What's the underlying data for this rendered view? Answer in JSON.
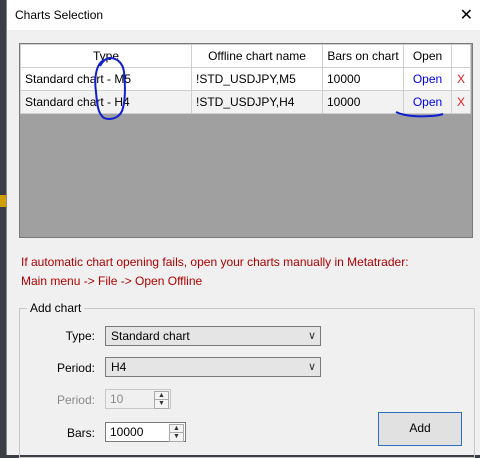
{
  "window": {
    "title": "Charts Selection",
    "close_glyph": "✕"
  },
  "table": {
    "headers": [
      "Type",
      "Offline chart name",
      "Bars on chart",
      "Open",
      ""
    ],
    "rows": [
      {
        "type": "Standard chart - M5",
        "name": "!STD_USDJPY,M5",
        "bars": "10000",
        "open": "Open",
        "remove": "X"
      },
      {
        "type": "Standard chart - H4",
        "name": "!STD_USDJPY,H4",
        "bars": "10000",
        "open": "Open",
        "remove": "X"
      }
    ]
  },
  "notes": {
    "line1": "If automatic chart opening fails, open your charts manually in Metatrader:",
    "line2": "Main menu -> File -> Open Offline"
  },
  "add_chart": {
    "group_label": "Add chart",
    "type_label": "Type:",
    "type_value": "Standard chart",
    "period_label": "Period:",
    "period_value": "H4",
    "period2_label": "Period:",
    "period2_value": "10",
    "bars_label": "Bars:",
    "bars_value": "10000",
    "add_button": "Add"
  },
  "colors": {
    "note": "#b00000",
    "link": "#0000ee",
    "remove": "#e02020",
    "annotation": "#1020d0"
  },
  "icons": {
    "dropdown": "chevron-down-icon",
    "spin_up": "arrow-up-icon",
    "spin_down": "arrow-down-icon"
  }
}
